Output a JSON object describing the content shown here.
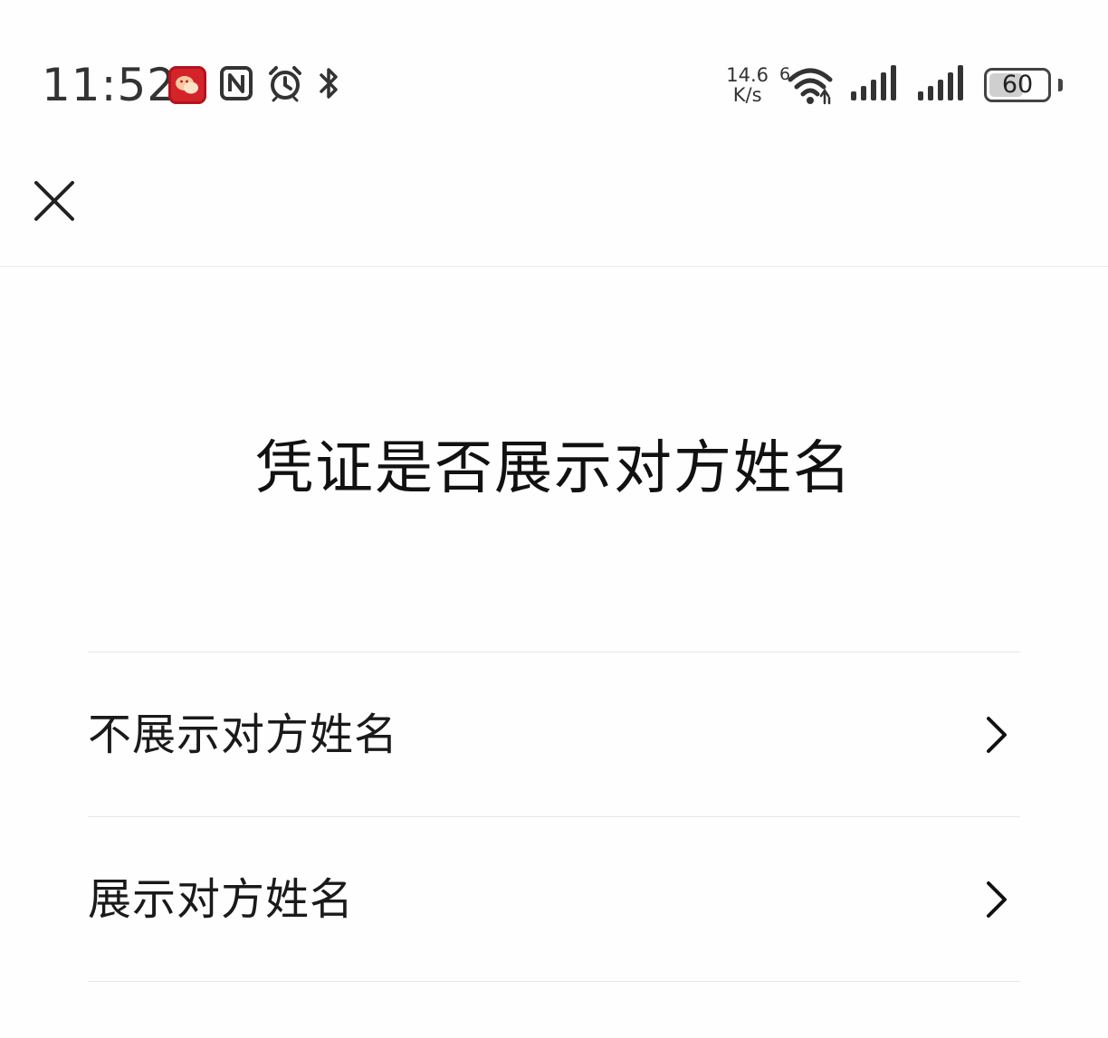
{
  "status_bar": {
    "time": "11:52",
    "net_speed_value": "14.6",
    "net_speed_unit": "K/s",
    "wifi_generation": "6",
    "battery_level": "60",
    "battery_fraction": 0.6,
    "icons": [
      "wechat-app-icon",
      "nfc-icon",
      "alarm-icon",
      "bluetooth-icon",
      "wifi-icon",
      "signal-icon",
      "signal-icon",
      "battery-icon"
    ]
  },
  "nav": {
    "close_icon": "close-icon"
  },
  "page": {
    "title": "凭证是否展示对方姓名"
  },
  "options": [
    {
      "label": "不展示对方姓名",
      "icon": "chevron-right-icon"
    },
    {
      "label": "展示对方姓名",
      "icon": "chevron-right-icon"
    }
  ],
  "colors": {
    "background": "#fefefe",
    "divider": "#e6e6e6",
    "text": "#111111",
    "app_icon": "#d3242b"
  }
}
